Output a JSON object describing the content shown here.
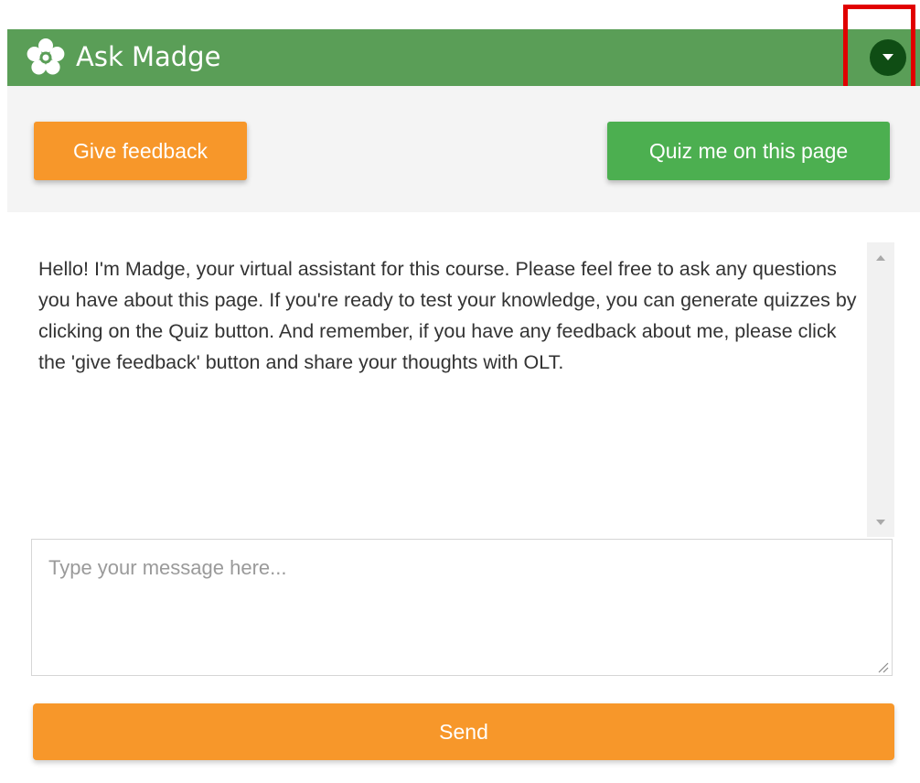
{
  "header": {
    "title": "Ask Madge",
    "logo_icon": "flower-icon",
    "collapse_icon": "caret-down-icon",
    "background_color": "#5a9e57",
    "collapse_button_color": "#0f4d14",
    "highlight_color": "#e10000"
  },
  "actions": {
    "feedback_label": "Give feedback",
    "feedback_color": "#f7972a",
    "quiz_label": "Quiz me on this page",
    "quiz_color": "#4caf50"
  },
  "chat": {
    "messages": [
      {
        "sender": "Madge",
        "text": "Hello! I'm Madge, your virtual assistant for this course. Please feel free to ask any questions you have about this page. If you're ready to test your knowledge, you can generate quizzes by clicking on the Quiz button. And remember, if you have any feedback about me, please click the 'give feedback' button and share your thoughts with OLT."
      }
    ]
  },
  "composer": {
    "value": "",
    "placeholder": "Type your message here...",
    "send_label": "Send",
    "send_color": "#f7972a"
  }
}
